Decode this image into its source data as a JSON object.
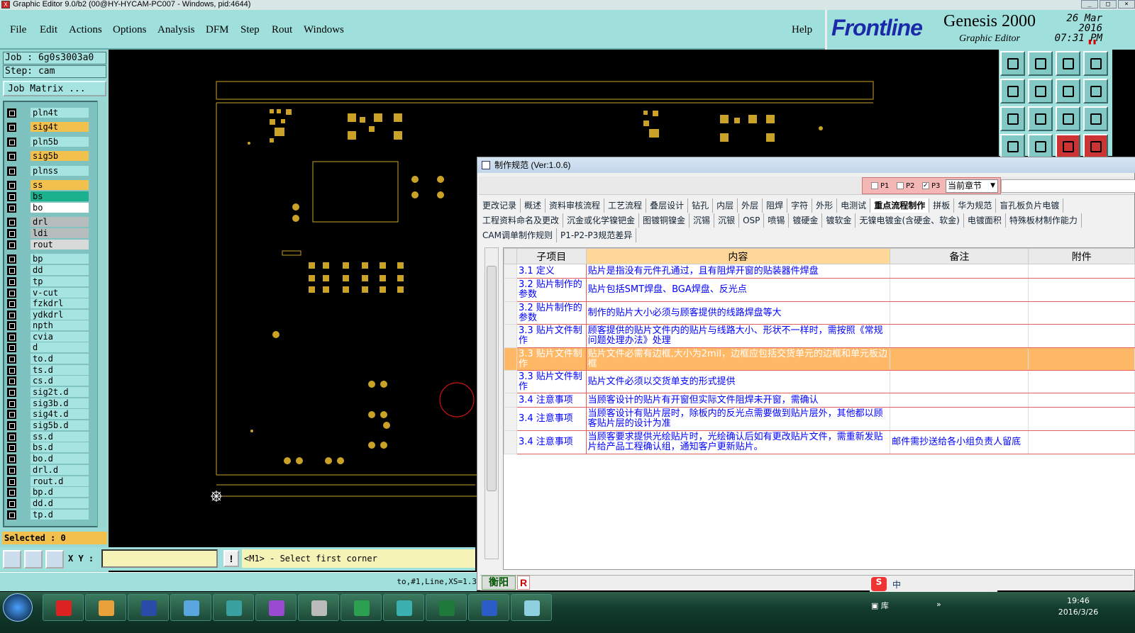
{
  "window": {
    "title": "Graphic Editor 9.0/b2 (00@HY-HYCAM-PC007 - Windows, pid:4644)"
  },
  "menu": {
    "items": [
      "File",
      "Edit",
      "Actions",
      "Options",
      "Analysis",
      "DFM",
      "Step",
      "Rout",
      "Windows"
    ],
    "help": "Help"
  },
  "brand": {
    "logo": "Frontline",
    "product": "Genesis 2000",
    "subtitle": "Graphic Editor",
    "date": "26 Mar 2016",
    "time": "07:31 PM"
  },
  "job": {
    "job_label": "Job : 6g0s3003a0",
    "step_label": "Step: cam",
    "matrix_button": "Job Matrix ..."
  },
  "layers": [
    {
      "name": "pln4t",
      "color": "#a6e4e1"
    },
    {
      "name": "sig4t",
      "color": "#f2c04d"
    },
    {
      "name": "pln5b",
      "color": "#a6e4e1"
    },
    {
      "name": "sig5b",
      "color": "#f2c04d"
    },
    {
      "name": "plnss",
      "color": "#a6e4e1"
    },
    {
      "name": "ss",
      "color": "#f2c04d"
    },
    {
      "name": "bs",
      "color": "#1bb08e"
    },
    {
      "name": "bo",
      "color": "#ffffff"
    },
    {
      "name": "drl",
      "color": "#b7bdbd"
    },
    {
      "name": "ldi",
      "color": "#b7bdbd"
    },
    {
      "name": "rout",
      "color": "#d8dada"
    },
    {
      "name": "bp",
      "color": "#a6e4e1"
    },
    {
      "name": "dd",
      "color": "#a6e4e1"
    },
    {
      "name": "tp",
      "color": "#a6e4e1"
    },
    {
      "name": "v-cut",
      "color": "#a6e4e1"
    },
    {
      "name": "fzkdrl",
      "color": "#a6e4e1"
    },
    {
      "name": "ydkdrl",
      "color": "#a6e4e1"
    },
    {
      "name": "npth",
      "color": "#a6e4e1"
    },
    {
      "name": "cvia",
      "color": "#a6e4e1"
    },
    {
      "name": "d",
      "color": "#a6e4e1"
    },
    {
      "name": "to.d",
      "color": "#a6e4e1"
    },
    {
      "name": "ts.d",
      "color": "#a6e4e1"
    },
    {
      "name": "cs.d",
      "color": "#a6e4e1"
    },
    {
      "name": "sig2t.d",
      "color": "#a6e4e1"
    },
    {
      "name": "sig3b.d",
      "color": "#a6e4e1"
    },
    {
      "name": "sig4t.d",
      "color": "#a6e4e1"
    },
    {
      "name": "sig5b.d",
      "color": "#a6e4e1"
    },
    {
      "name": "ss.d",
      "color": "#a6e4e1"
    },
    {
      "name": "bs.d",
      "color": "#a6e4e1"
    },
    {
      "name": "bo.d",
      "color": "#a6e4e1"
    },
    {
      "name": "drl.d",
      "color": "#a6e4e1"
    },
    {
      "name": "rout.d",
      "color": "#a6e4e1"
    },
    {
      "name": "bp.d",
      "color": "#a6e4e1"
    },
    {
      "name": "dd.d",
      "color": "#a6e4e1"
    },
    {
      "name": "tp.d",
      "color": "#a6e4e1"
    }
  ],
  "status": {
    "selected": "Selected : 0",
    "xy_label": "X Y :",
    "xy_value": "",
    "prompt": "<M1> - Select first corner",
    "info_icon": "!",
    "feature": "to,#1,Line,XS=1.3"
  },
  "dialog": {
    "title": "制作规范 (Ver:1.0.6)",
    "toggles": [
      "P1",
      "P2",
      "P3"
    ],
    "chapter_select": "当前章节",
    "tabs_row1": [
      "更改记录",
      "概述",
      "资料审核流程",
      "工艺流程",
      "叠层设计",
      "钻孔",
      "内层",
      "外层",
      "阻焊",
      "字符",
      "外形",
      "电测试",
      "重点流程制作",
      "拼板",
      "华为规范",
      "盲孔板负片电镀"
    ],
    "active_tab": "重点流程制作",
    "tabs_row2": [
      "工程资料命名及更改",
      "沉金或化学镍钯金",
      "图镀铜镍金",
      "沉锡",
      "沉银",
      "OSP",
      "喷锡",
      "镀硬金",
      "镀软金",
      "无镍电镀金(含硬金、软金)",
      "电镀面积",
      "特殊板材制作能力"
    ],
    "tabs_row3": [
      "CAM调单制作规则",
      "P1-P2-P3规范差异"
    ],
    "columns": [
      "子项目",
      "内容",
      "备注",
      "附件"
    ],
    "rows": [
      {
        "item": "3.1 定义",
        "content": "贴片是指没有元件孔通过，且有阻焊开窗的贴装器件焊盘",
        "note": ""
      },
      {
        "item": "3.2 贴片制作的参数",
        "content": "贴片包括SMT焊盘、BGA焊盘、反光点",
        "note": ""
      },
      {
        "item": "3.2 贴片制作的参数",
        "content": "制作的贴片大小必须与顾客提供的线路焊盘等大",
        "note": ""
      },
      {
        "item": "3.3 贴片文件制作",
        "content": "顾客提供的贴片文件内的贴片与线路大小、形状不一样时，需按照《常规问题处理办法》处理",
        "note": ""
      },
      {
        "item": "3.3 贴片文件制作",
        "content": "贴片文件必需有边框,大小为2mil，边框应包括交货单元的边框和单元板边框",
        "note": "",
        "selected": true
      },
      {
        "item": "3.3 贴片文件制作",
        "content": "贴片文件必须以交货单支的形式提供",
        "note": ""
      },
      {
        "item": "3.4 注意事项",
        "content": "当顾客设计的贴片有开窗但实际文件阻焊未开窗，需确认",
        "note": ""
      },
      {
        "item": "3.4 注意事项",
        "content": "当顾客设计有贴片层时，除板内的反光点需要做到贴片层外，其他都以顾客贴片层的设计为准",
        "note": ""
      },
      {
        "item": "3.4 注意事项",
        "content": "当顾客要求提供光绘贴片时，光绘确认后如有更改贴片文件，需重新发贴片给产品工程确认组，通知客户更新贴片。",
        "note": "邮件需抄送给各小组负责人留底"
      }
    ],
    "footer_label": "衡阳",
    "footer_r": "R"
  },
  "tray": {
    "ime": "中",
    "lib": "库",
    "time": "19:46",
    "date": "2016/3/26"
  },
  "colors": {
    "accent": "#9fe0dd",
    "trace": "#c9a227",
    "outline": "#d8b040"
  }
}
